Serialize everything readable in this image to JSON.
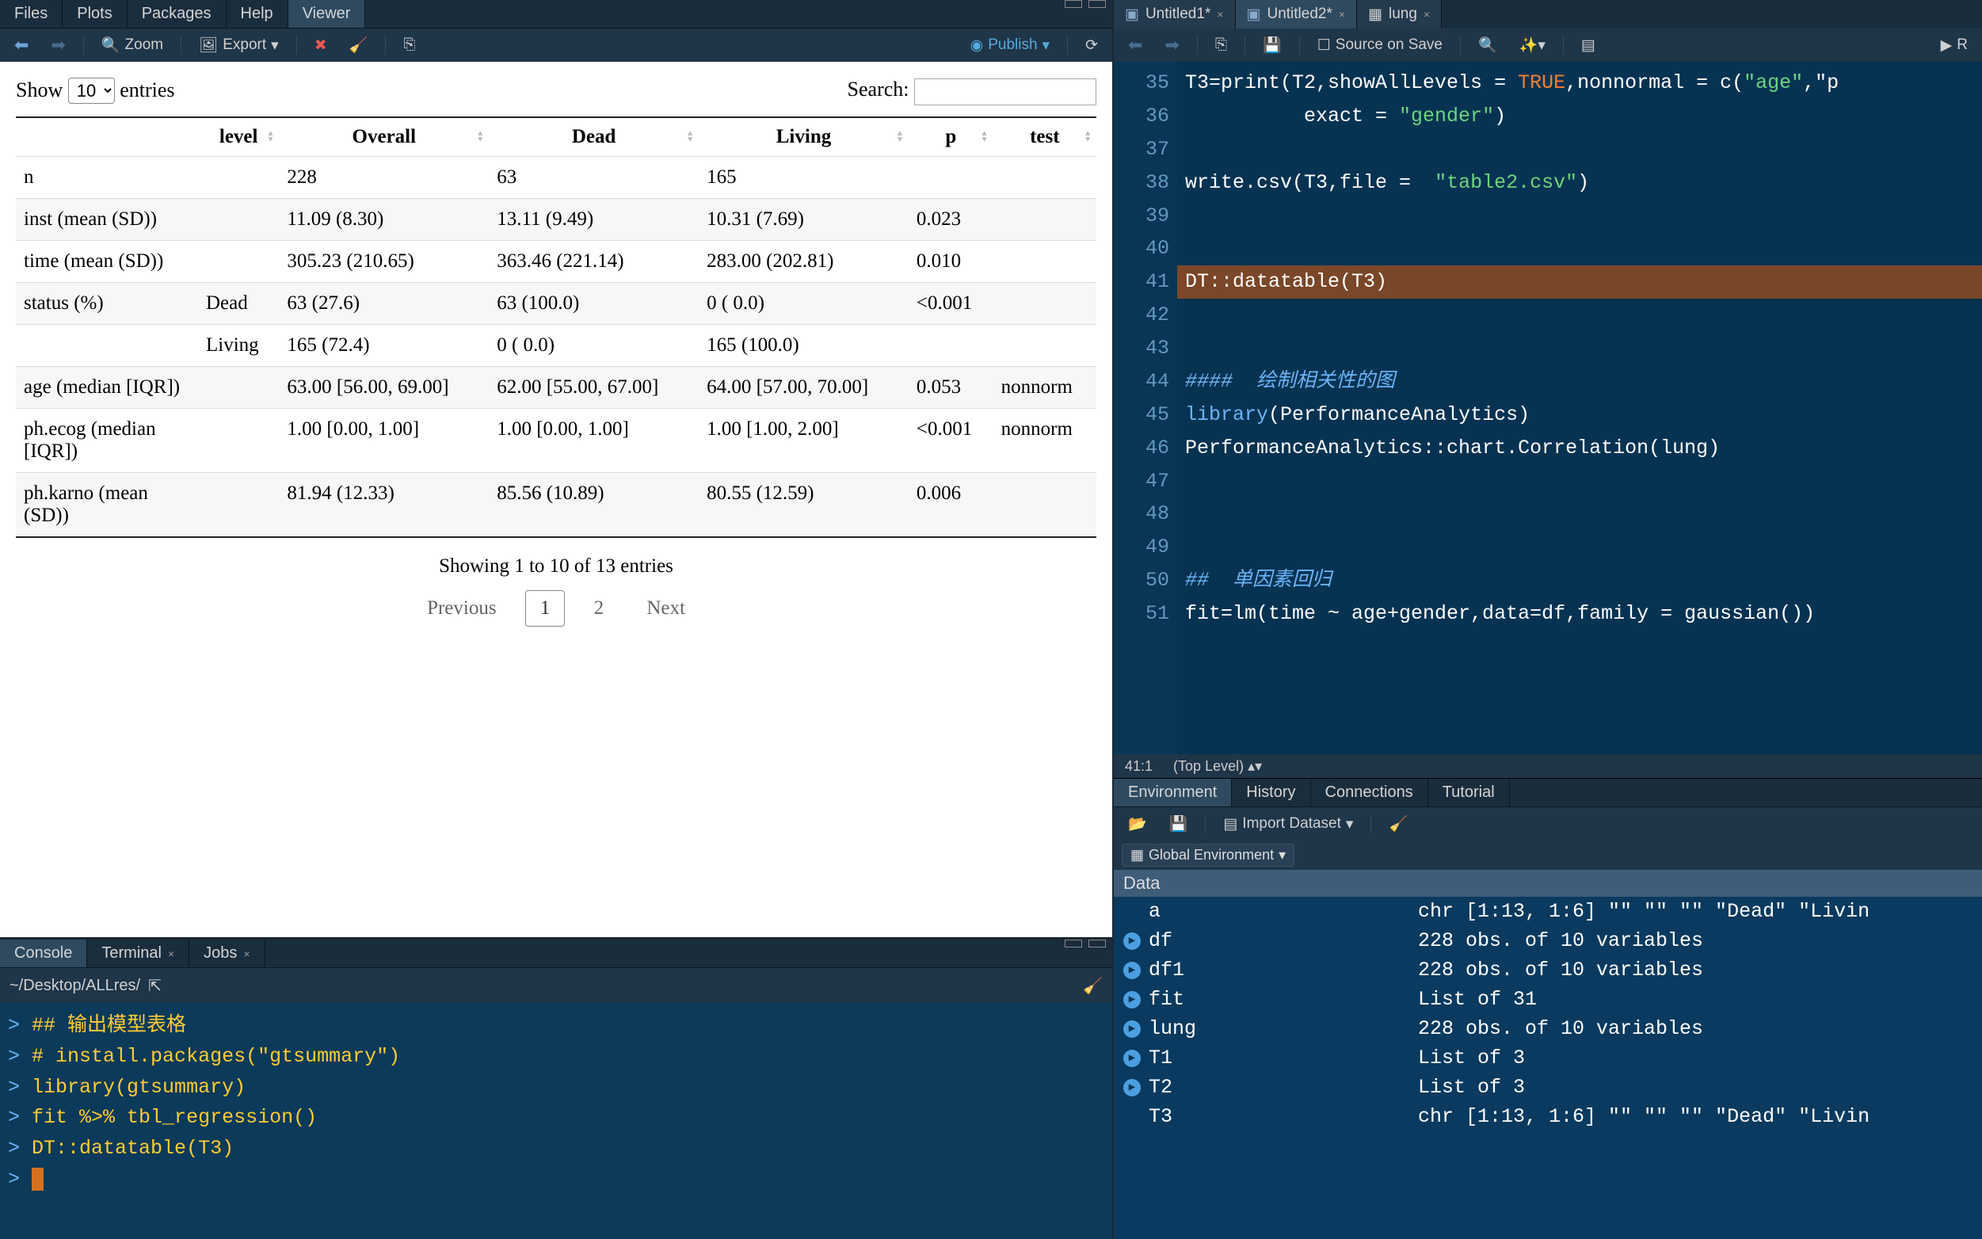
{
  "viewerTabs": {
    "tabs": [
      "Files",
      "Plots",
      "Packages",
      "Help",
      "Viewer"
    ],
    "active": 4
  },
  "viewerToolbar": {
    "zoom": "Zoom",
    "export": "Export",
    "publish": "Publish"
  },
  "datatable": {
    "showPrefix": "Show",
    "showCount": "10",
    "entriesSuffix": "entries",
    "searchLabel": "Search:",
    "searchValue": "",
    "headers": [
      "",
      "level",
      "Overall",
      "Dead",
      "Living",
      "p",
      "test"
    ],
    "rows": [
      {
        "c0": "n",
        "c1": "",
        "c2": "228",
        "c3": "63",
        "c4": "165",
        "c5": "",
        "c6": ""
      },
      {
        "c0": "inst (mean (SD))",
        "c1": "",
        "c2": "11.09 (8.30)",
        "c3": "13.11 (9.49)",
        "c4": "10.31 (7.69)",
        "c5": "0.023",
        "c6": ""
      },
      {
        "c0": "time (mean (SD))",
        "c1": "",
        "c2": "305.23 (210.65)",
        "c3": "363.46 (221.14)",
        "c4": "283.00 (202.81)",
        "c5": "0.010",
        "c6": ""
      },
      {
        "c0": "status (%)",
        "c1": "Dead",
        "c2": "63 (27.6)",
        "c3": "63 (100.0)",
        "c4": "0 ( 0.0)",
        "c5": "<0.001",
        "c6": ""
      },
      {
        "c0": "",
        "c1": "Living",
        "c2": "165 (72.4)",
        "c3": "0 ( 0.0)",
        "c4": "165 (100.0)",
        "c5": "",
        "c6": ""
      },
      {
        "c0": "age (median [IQR])",
        "c1": "",
        "c2": "63.00 [56.00, 69.00]",
        "c3": "62.00 [55.00, 67.00]",
        "c4": "64.00 [57.00, 70.00]",
        "c5": "0.053",
        "c6": "nonnorm"
      },
      {
        "c0": "ph.ecog (median [IQR])",
        "c1": "",
        "c2": "1.00 [0.00, 1.00]",
        "c3": "1.00 [0.00, 1.00]",
        "c4": "1.00 [1.00, 2.00]",
        "c5": "<0.001",
        "c6": "nonnorm"
      },
      {
        "c0": "ph.karno (mean (SD))",
        "c1": "",
        "c2": "81.94 (12.33)",
        "c3": "85.56 (10.89)",
        "c4": "80.55 (12.59)",
        "c5": "0.006",
        "c6": ""
      }
    ],
    "info": "Showing 1 to 10 of 13 entries",
    "prev": "Previous",
    "next": "Next",
    "pages": [
      "1",
      "2"
    ],
    "current": 0
  },
  "console": {
    "tabs": [
      "Console",
      "Terminal",
      "Jobs"
    ],
    "active": 0,
    "wd": "~/Desktop/ALLres/",
    "lines": [
      "## 输出模型表格",
      "# install.packages(\"gtsummary\")",
      "library(gtsummary)",
      "fit %>% tbl_regression()",
      "DT::datatable(T3)"
    ]
  },
  "editor": {
    "tabs": [
      {
        "name": "Untitled1*",
        "icon": "rdoc-icon"
      },
      {
        "name": "Untitled2*",
        "icon": "rdoc-icon"
      },
      {
        "name": "lung",
        "icon": "table-icon"
      }
    ],
    "active": 1,
    "toolbar": {
      "source": "Source on Save",
      "run": "R"
    },
    "gutterStart": 35,
    "statusPos": "41:1",
    "statusScope": "(Top Level)",
    "chart_data": null
  },
  "codeLines": [
    {
      "num": "35",
      "plain": "T3=print(T2,showAllLevels = ",
      "const": "TRUE",
      "rest": ",nonnormal = c(",
      "str": "\"age\"",
      "tail": ",\"p"
    },
    {
      "num": "36",
      "indent": "          exact = ",
      "str": "\"gender\"",
      "tail": ")"
    },
    {
      "num": "37",
      "plain": ""
    },
    {
      "num": "38",
      "plain": "write.csv(T3,file =  ",
      "str": "\"table2.csv\"",
      "tail": ")"
    },
    {
      "num": "39",
      "plain": ""
    },
    {
      "num": "40",
      "plain": ""
    },
    {
      "num": "41",
      "plain": "DT::datatable(T3)",
      "hl": true
    },
    {
      "num": "42",
      "plain": ""
    },
    {
      "num": "43",
      "plain": ""
    },
    {
      "num": "44",
      "cmt": "####  绘制相关性的图"
    },
    {
      "num": "45",
      "kw": "library",
      "plain": "(PerformanceAnalytics)"
    },
    {
      "num": "46",
      "plain": "PerformanceAnalytics::chart.Correlation(lung)"
    },
    {
      "num": "47",
      "plain": ""
    },
    {
      "num": "48",
      "plain": ""
    },
    {
      "num": "49",
      "plain": ""
    },
    {
      "num": "50",
      "cmt": "##  单因素回归"
    },
    {
      "num": "51",
      "plain": "fit=lm(time ~ age+gender,data=df,family = gaussian())"
    }
  ],
  "env": {
    "tabs": [
      "Environment",
      "History",
      "Connections",
      "Tutorial"
    ],
    "active": 0,
    "toolbar": {
      "import": "Import Dataset"
    },
    "scope": "Global Environment",
    "section": "Data",
    "items": [
      {
        "name": "a",
        "expand": false,
        "value": "chr [1:13, 1:6] \"\" \"\" \"\" \"Dead\" \"Livin"
      },
      {
        "name": "df",
        "expand": true,
        "value": "228 obs. of 10 variables"
      },
      {
        "name": "df1",
        "expand": true,
        "value": "228 obs. of 10 variables"
      },
      {
        "name": "fit",
        "expand": true,
        "value": "List of 31"
      },
      {
        "name": "lung",
        "expand": true,
        "value": "228 obs. of 10 variables"
      },
      {
        "name": "T1",
        "expand": true,
        "value": "List of 3"
      },
      {
        "name": "T2",
        "expand": true,
        "value": "List of 3"
      },
      {
        "name": "T3",
        "expand": false,
        "value": "chr [1:13, 1:6] \"\" \"\" \"\" \"Dead\" \"Livin"
      }
    ]
  }
}
